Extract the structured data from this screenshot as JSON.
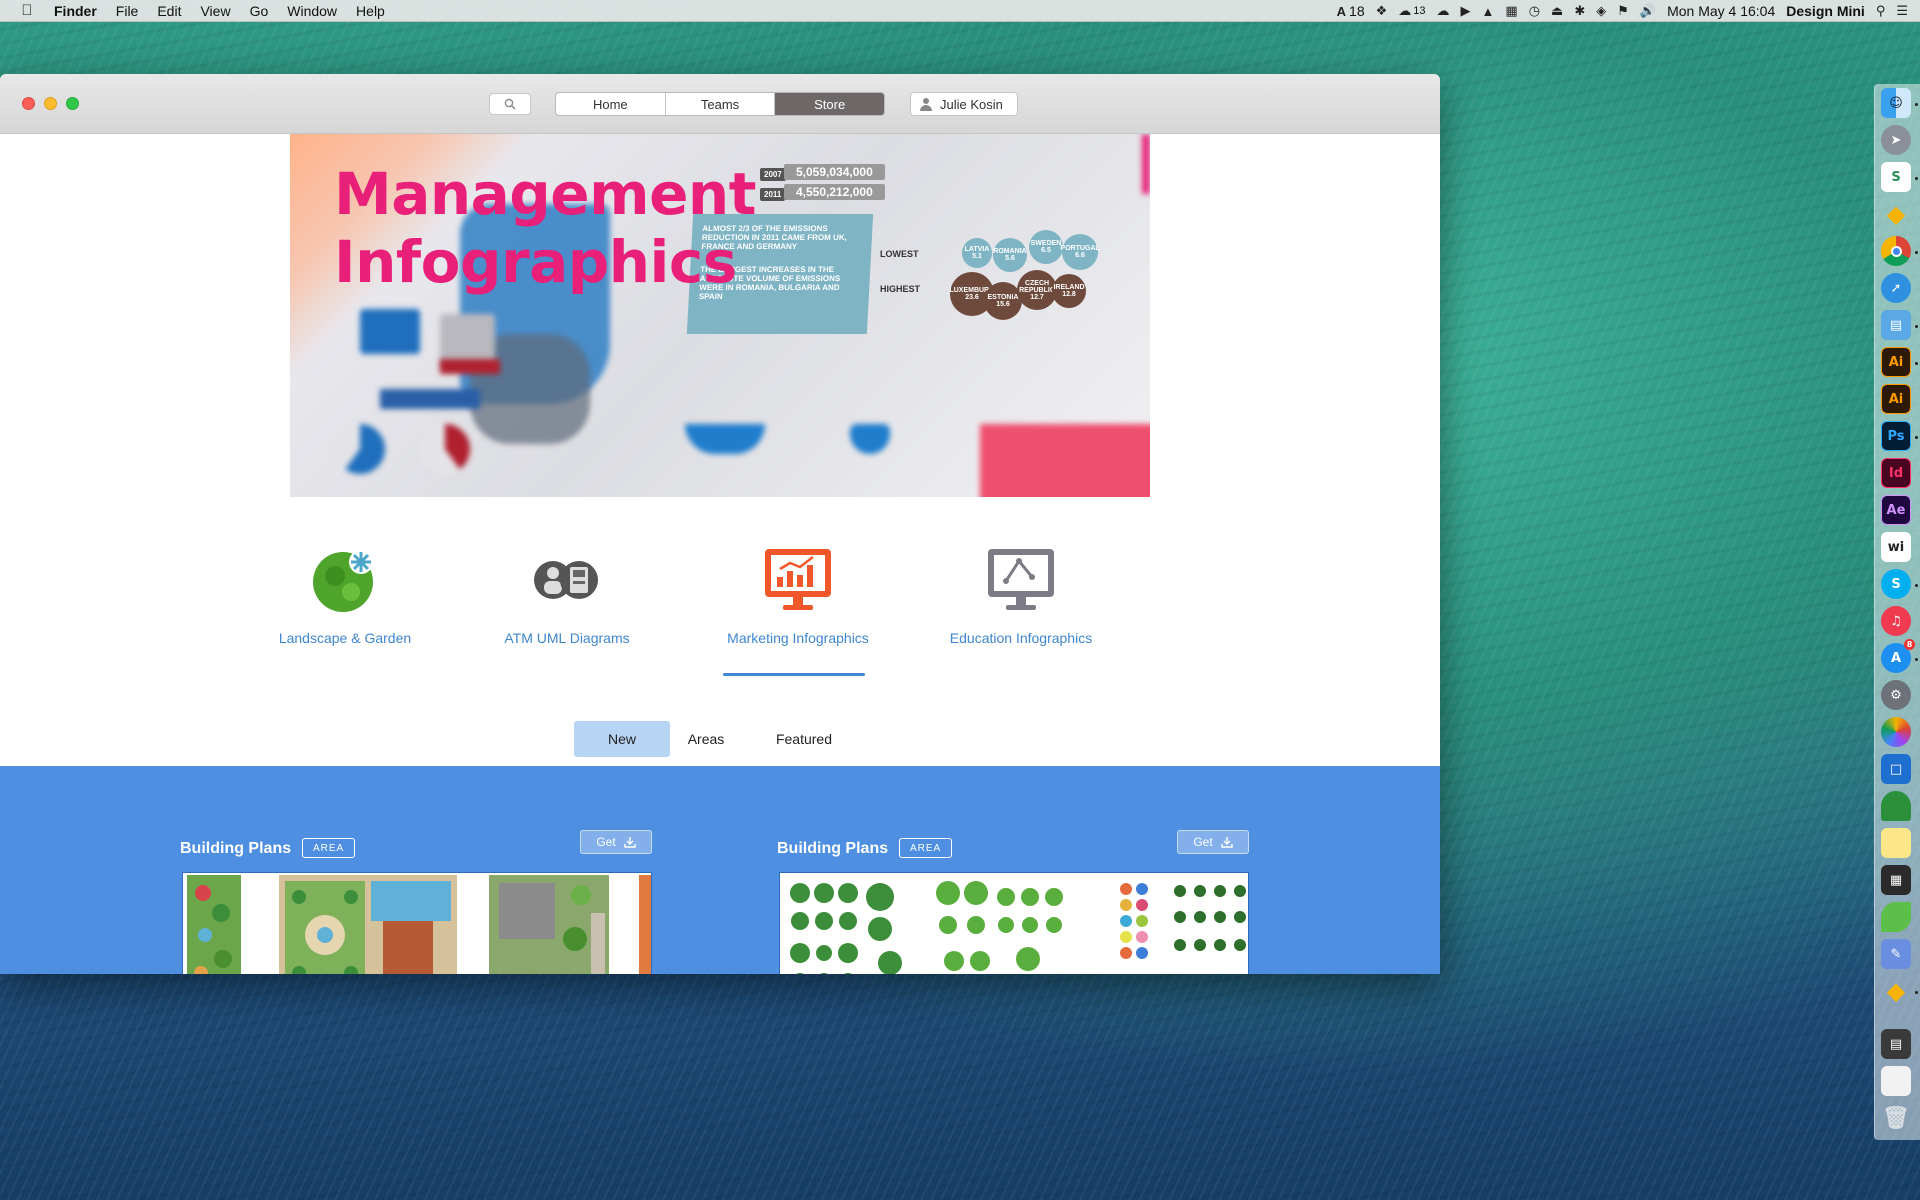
{
  "menubar": {
    "app_name": "Finder",
    "menus": [
      "File",
      "Edit",
      "View",
      "Go",
      "Window",
      "Help"
    ],
    "status": {
      "adobe_count": "18",
      "cc_count": "13",
      "datetime": "Mon May 4  16:04",
      "user": "Design Mini"
    }
  },
  "window": {
    "nav_tabs": [
      {
        "label": "Home",
        "active": false
      },
      {
        "label": "Teams",
        "active": false
      },
      {
        "label": "Store",
        "active": true
      }
    ],
    "user_name": "Julie Kosin"
  },
  "hero": {
    "title_line1": "Management",
    "title_line2": "Infographics",
    "stat_2007": "2007",
    "stat_value_1": "5,059,034,000",
    "stat_2011": "2011",
    "stat_value_2": "4,550,212,000",
    "panel_text_1": "ALMOST 2/3 OF THE EMISSIONS REDUCTION IN 2011 CAME FROM UK, FRANCE AND GERMANY",
    "panel_text_2": "THE LARGEST INCREASES IN THE ABSOLUTE VOLUME OF EMISSIONS WERE IN ROMANIA, BULGARIA AND SPAIN",
    "lowest_label": "LOWEST",
    "highest_label": "HIGHEST",
    "bubbles_teal": [
      "LATVIA 5.1",
      "ROMANIA 5.6",
      "SWEDEN 6.5",
      "PORTUGAL 6.6"
    ],
    "bubbles_brown": [
      "LUXEMBURG 23.6",
      "ESTONIA 15.6",
      "CZECH REPUBLIC 12.7",
      "IRELAND 12.8"
    ]
  },
  "categories": [
    {
      "label": "Landscape & Garden",
      "icon": "garden-icon",
      "active": false
    },
    {
      "label": "ATM UML Diagrams",
      "icon": "atm-icon",
      "active": false
    },
    {
      "label": "Marketing Infographics",
      "icon": "chart-monitor-icon",
      "active": true
    },
    {
      "label": "Education Infographics",
      "icon": "diagram-monitor-icon",
      "active": false
    }
  ],
  "filters": [
    {
      "label": "New",
      "active": true
    },
    {
      "label": "Areas",
      "active": false
    },
    {
      "label": "Featured",
      "active": false
    }
  ],
  "cards": [
    {
      "title": "Building Plans",
      "badge": "AREA",
      "get_label": "Get"
    },
    {
      "title": "Building Plans",
      "badge": "AREA",
      "get_label": "Get"
    }
  ],
  "colors": {
    "accent_blue": "#4e8fe2",
    "hero_pink": "#e8207a",
    "marketing_orange": "#f0572a"
  },
  "dock": {
    "apps": [
      "finder-icon",
      "launchpad-icon",
      "sketch-s-icon",
      "sketch-icon",
      "chrome-icon",
      "safari-icon",
      "preview-icon",
      "illustrator-icon",
      "illustrator-icon",
      "photoshop-icon",
      "indesign-icon",
      "after-effects-icon",
      "word-icon",
      "skype-icon",
      "itunes-icon",
      "app-store-icon",
      "system-preferences-icon",
      "photos-icon",
      "keynote-icon",
      "turtle-icon",
      "notes-icon",
      "numbers-icon",
      "leaf-icon",
      "xcode-icon",
      "sketch-icon",
      "scanner-icon",
      "blank-icon",
      "trash-icon"
    ],
    "labels": {
      "sketch_s": "S",
      "illustrator": "Ai",
      "photoshop": "Ps",
      "indesign": "Id",
      "after_effects": "Ae",
      "word": "wi",
      "app_store_badge": "8"
    }
  }
}
